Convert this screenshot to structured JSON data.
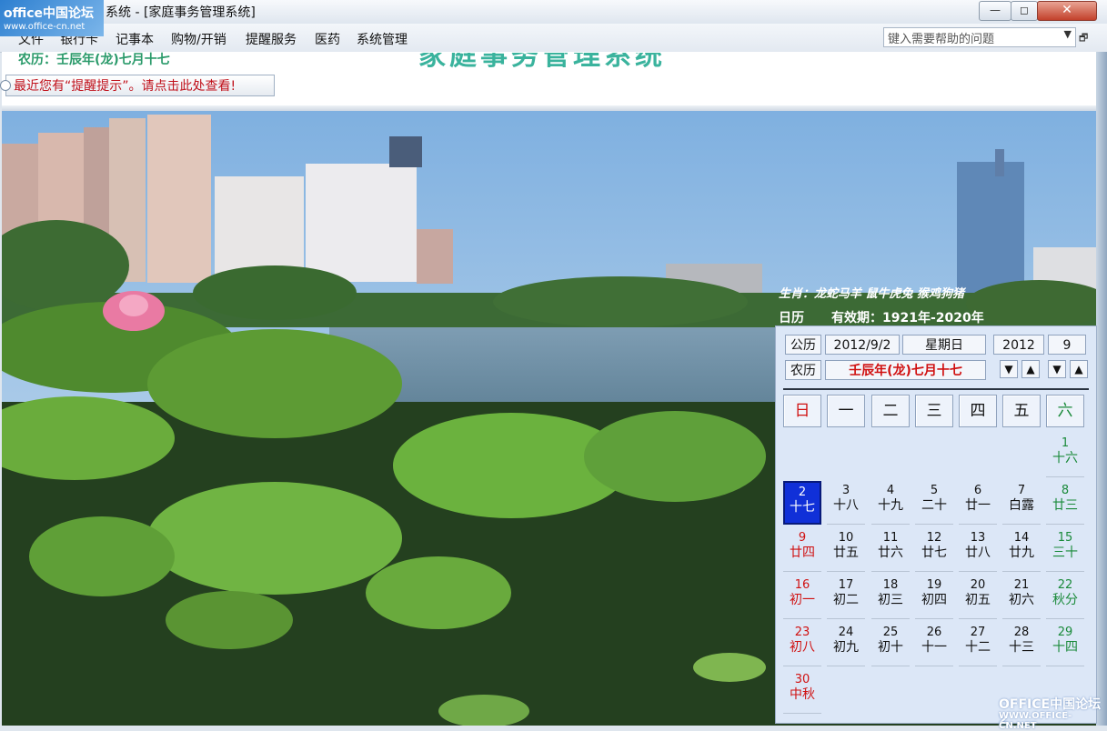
{
  "window": {
    "title": "系统 - [家庭事务管理系统]",
    "min_label": "—",
    "max_label": "◻",
    "close_label": "✕"
  },
  "logo": {
    "main": "office中国论坛",
    "url": "www.office-cn.net"
  },
  "menu": {
    "items": [
      "文件",
      "银行卡",
      "记事本",
      "购物/开销",
      "提醒服务",
      "医药",
      "系统管理"
    ],
    "help_placeholder": "键入需要帮助的问题"
  },
  "header": {
    "lunar": "农历：壬辰年(龙)七月十七",
    "app_title": "家庭事务管理系统",
    "reminder": "最近您有“提醒提示”。请点击此处查看!"
  },
  "calendar": {
    "zodiac": "生肖：龙蛇马羊 鼠牛虎兔 猴鸡狗猪",
    "caption": "日历",
    "validity": "有效期：1921年-2020年",
    "gregorian_label": "公历",
    "gregorian_date": "2012/9/2",
    "weekday": "星期日",
    "year": "2012",
    "month": "9",
    "lunar_label": "农历",
    "lunar_date": "壬辰年(龙)七月十七",
    "weekdays": [
      "日",
      "一",
      "二",
      "三",
      "四",
      "五",
      "六"
    ],
    "selected_day": "2",
    "days": [
      {
        "n": "1",
        "l": "十六",
        "col": 6,
        "row": 0,
        "c": "green"
      },
      {
        "n": "2",
        "l": "十七",
        "col": 0,
        "row": 1,
        "c": "red"
      },
      {
        "n": "3",
        "l": "十八",
        "col": 1,
        "row": 1,
        "c": "black"
      },
      {
        "n": "4",
        "l": "十九",
        "col": 2,
        "row": 1,
        "c": "black"
      },
      {
        "n": "5",
        "l": "二十",
        "col": 3,
        "row": 1,
        "c": "black"
      },
      {
        "n": "6",
        "l": "廿一",
        "col": 4,
        "row": 1,
        "c": "black"
      },
      {
        "n": "7",
        "l": "白露",
        "col": 5,
        "row": 1,
        "c": "black"
      },
      {
        "n": "8",
        "l": "廿三",
        "col": 6,
        "row": 1,
        "c": "green"
      },
      {
        "n": "9",
        "l": "廿四",
        "col": 0,
        "row": 2,
        "c": "red"
      },
      {
        "n": "10",
        "l": "廿五",
        "col": 1,
        "row": 2,
        "c": "black"
      },
      {
        "n": "11",
        "l": "廿六",
        "col": 2,
        "row": 2,
        "c": "black"
      },
      {
        "n": "12",
        "l": "廿七",
        "col": 3,
        "row": 2,
        "c": "black"
      },
      {
        "n": "13",
        "l": "廿八",
        "col": 4,
        "row": 2,
        "c": "black"
      },
      {
        "n": "14",
        "l": "廿九",
        "col": 5,
        "row": 2,
        "c": "black"
      },
      {
        "n": "15",
        "l": "三十",
        "col": 6,
        "row": 2,
        "c": "green"
      },
      {
        "n": "16",
        "l": "初一",
        "col": 0,
        "row": 3,
        "c": "red"
      },
      {
        "n": "17",
        "l": "初二",
        "col": 1,
        "row": 3,
        "c": "black"
      },
      {
        "n": "18",
        "l": "初三",
        "col": 2,
        "row": 3,
        "c": "black"
      },
      {
        "n": "19",
        "l": "初四",
        "col": 3,
        "row": 3,
        "c": "black"
      },
      {
        "n": "20",
        "l": "初五",
        "col": 4,
        "row": 3,
        "c": "black"
      },
      {
        "n": "21",
        "l": "初六",
        "col": 5,
        "row": 3,
        "c": "black"
      },
      {
        "n": "22",
        "l": "秋分",
        "col": 6,
        "row": 3,
        "c": "green"
      },
      {
        "n": "23",
        "l": "初八",
        "col": 0,
        "row": 4,
        "c": "red"
      },
      {
        "n": "24",
        "l": "初九",
        "col": 1,
        "row": 4,
        "c": "black"
      },
      {
        "n": "25",
        "l": "初十",
        "col": 2,
        "row": 4,
        "c": "black"
      },
      {
        "n": "26",
        "l": "十一",
        "col": 3,
        "row": 4,
        "c": "black"
      },
      {
        "n": "27",
        "l": "十二",
        "col": 4,
        "row": 4,
        "c": "black"
      },
      {
        "n": "28",
        "l": "十三",
        "col": 5,
        "row": 4,
        "c": "black"
      },
      {
        "n": "29",
        "l": "十四",
        "col": 6,
        "row": 4,
        "c": "green"
      },
      {
        "n": "30",
        "l": "中秋",
        "col": 0,
        "row": 5,
        "c": "red"
      }
    ]
  },
  "watermark": {
    "main": "OFFICE中国论坛2",
    "url": "WWW.OFFICE-CN.NET"
  }
}
